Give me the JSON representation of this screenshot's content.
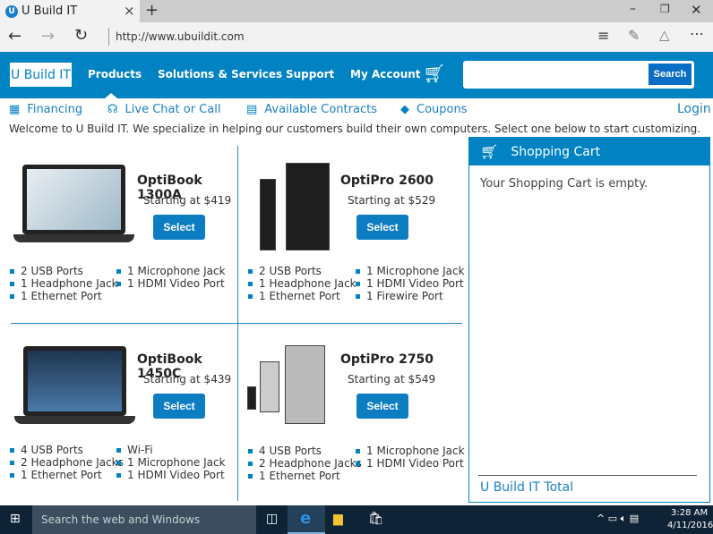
{
  "browser": {
    "tab_title": "U Build IT",
    "url": "http://www.ubuildit.com"
  },
  "nav": {
    "brand": "U Build IT",
    "items": [
      "Products",
      "Solutions & Services",
      "Support",
      "My Account"
    ],
    "search_placeholder": "",
    "search_button": "Search"
  },
  "subnav": {
    "items": [
      "Financing",
      "Live Chat or Call",
      "Available Contracts",
      "Coupons"
    ],
    "login": "Login"
  },
  "welcome": "Welcome to U Build IT. We specialize in helping our customers build their own computers. Select one below to start customizing.",
  "select_label": "Select",
  "products": [
    {
      "name": "OptiBook 1300A",
      "price": "Starting at $419",
      "features_left": [
        "2 USB Ports",
        "1 Headphone Jack",
        "1 Ethernet Port"
      ],
      "features_right": [
        "1 Microphone Jack",
        "1 HDMI Video Port"
      ]
    },
    {
      "name": "OptiPro 2600",
      "price": "Starting at $529",
      "features_left": [
        "2 USB Ports",
        "1 Headphone Jack",
        "1 Ethernet Port"
      ],
      "features_right": [
        "1 Microphone Jack",
        "1 HDMI Video Port",
        "1 Firewire Port"
      ]
    },
    {
      "name": "OptiBook 1450C",
      "price": "Starting at $439",
      "features_left": [
        "4 USB Ports",
        "2 Headphone Jacks",
        "1 Ethernet Port"
      ],
      "features_right": [
        "Wi-Fi",
        "1 Microphone Jack",
        "1 HDMI Video Port"
      ]
    },
    {
      "name": "OptiPro 2750",
      "price": "Starting at $549",
      "features_left": [
        "4 USB Ports",
        "2 Headphone Jacks",
        "1 Ethernet Port"
      ],
      "features_right": [
        "1 Microphone Jack",
        "1 HDMI Video Port"
      ]
    }
  ],
  "cart": {
    "title": "Shopping Cart",
    "empty": "Your Shopping Cart is empty.",
    "total_label": "U Build IT Total"
  },
  "taskbar": {
    "search": "Search the web and Windows",
    "time": "3:28 AM",
    "date": "4/11/2016"
  },
  "colors": {
    "brand": "#0082c3"
  }
}
